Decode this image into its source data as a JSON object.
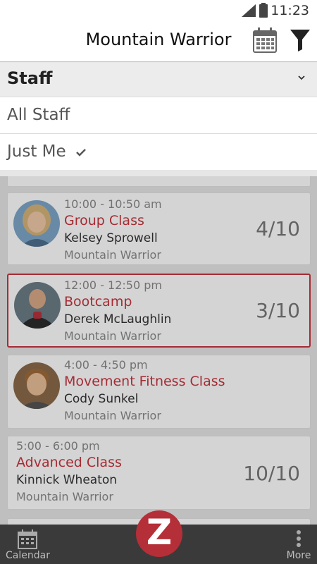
{
  "status_bar": {
    "time": "11:23"
  },
  "header": {
    "title": "Mountain Warrior"
  },
  "filter": {
    "section_label": "Staff",
    "options": [
      {
        "label": "All Staff",
        "selected": false
      },
      {
        "label": "Just Me",
        "selected": true
      }
    ]
  },
  "classes": [
    {
      "time": "10:00 - 10:50 am",
      "name": "Group Class",
      "instructor": "Kelsey Sprowell",
      "location": "Mountain Warrior",
      "count": "4/10",
      "avatar": true,
      "selected": false
    },
    {
      "time": "12:00 - 12:50 pm",
      "name": "Bootcamp",
      "instructor": "Derek McLaughlin",
      "location": "Mountain Warrior",
      "count": "3/10",
      "avatar": true,
      "selected": true
    },
    {
      "time": "4:00 - 4:50 pm",
      "name": "Movement Fitness Class",
      "instructor": "Cody Sunkel",
      "location": "Mountain Warrior",
      "count": "",
      "avatar": true,
      "selected": false
    },
    {
      "time": "5:00 - 6:00 pm",
      "name": "Advanced Class",
      "instructor": "Kinnick Wheaton",
      "location": "Mountain Warrior",
      "count": "10/10",
      "avatar": false,
      "selected": false
    }
  ],
  "bottom_nav": {
    "calendar_label": "Calendar",
    "more_label": "More",
    "fab_letter": "Z"
  },
  "colors": {
    "accent": "#c7353f",
    "bottom_bar": "#3a3a3a"
  }
}
